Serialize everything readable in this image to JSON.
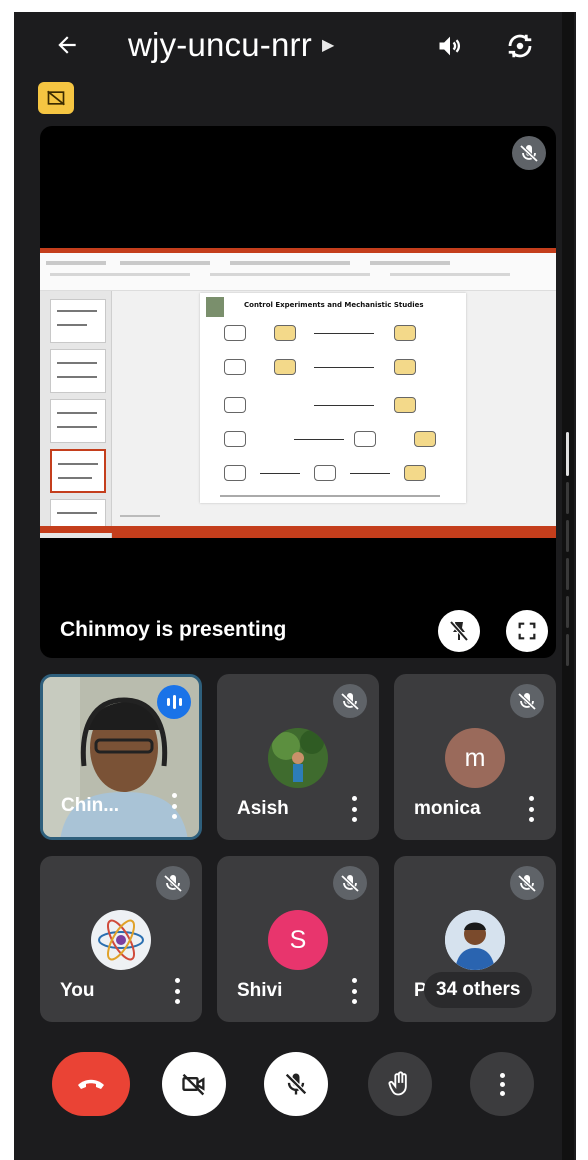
{
  "meeting": {
    "code": "wjy-uncu-nrr"
  },
  "topbar": {
    "icons": [
      "back-arrow-icon",
      "caret-right-icon",
      "speaker-icon",
      "switch-camera-icon",
      "camera-off-badge-icon"
    ]
  },
  "presentation": {
    "presenting_label": "Chinmoy is presenting",
    "slide_title": "Control Experiments and Mechanistic Studies",
    "controls": [
      "unpin-icon",
      "fullscreen-icon"
    ]
  },
  "participants": [
    {
      "name": "Chin...",
      "video": true,
      "speaking": true
    },
    {
      "name": "Asish",
      "muted": true,
      "avatar": "photo"
    },
    {
      "name": "monica",
      "muted": true,
      "avatar_letter": "m",
      "avatar_color": "#9a6a5b"
    },
    {
      "name": "You",
      "muted": true,
      "avatar": "atom-logo"
    },
    {
      "name": "Shivi",
      "muted": true,
      "avatar_letter": "S",
      "avatar_color": "#e8356d"
    },
    {
      "name": "Pr",
      "muted": true,
      "avatar": "photo",
      "others_label": "34 others"
    }
  ],
  "controls": {
    "buttons": [
      "end-call",
      "camera-off",
      "mic-off",
      "raise-hand",
      "more-options"
    ],
    "end_call_color": "#ea4335"
  }
}
